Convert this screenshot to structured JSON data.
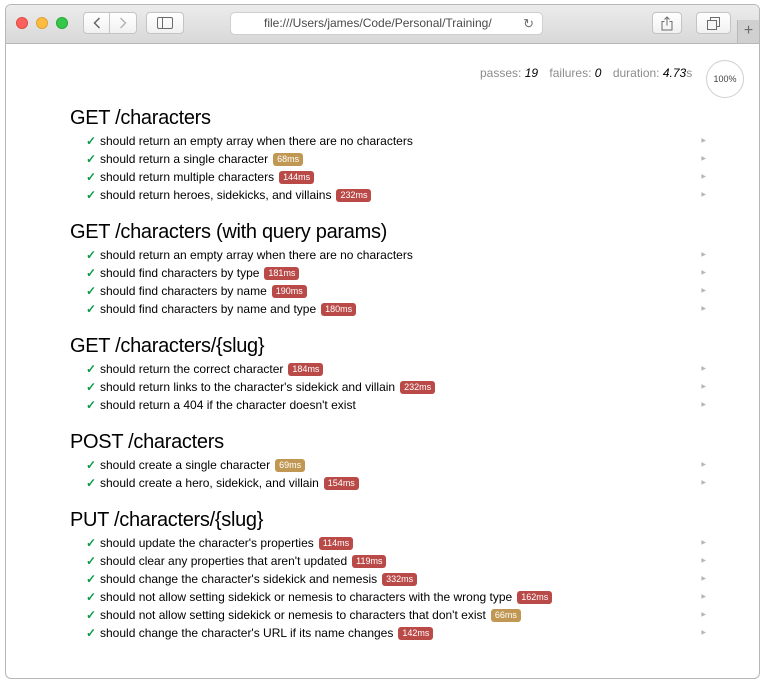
{
  "browser": {
    "url": "file:///Users/james/Code/Personal/Training/",
    "newtab_label": "+"
  },
  "stats": {
    "passes_label": "passes:",
    "passes": "19",
    "failures_label": "failures:",
    "failures": "0",
    "duration_label": "duration:",
    "duration": "4.73",
    "duration_unit": "s",
    "progress": "100%"
  },
  "colors": {
    "pass": "#0a9a4a",
    "medium": "#c09853",
    "slow": "#b94a48"
  },
  "suites": [
    {
      "title": "GET /characters",
      "tests": [
        {
          "title": "should return an empty array when there are no characters",
          "duration": "",
          "speed": "fast"
        },
        {
          "title": "should return a single character",
          "duration": "68ms",
          "speed": "medium"
        },
        {
          "title": "should return multiple characters",
          "duration": "144ms",
          "speed": "slow"
        },
        {
          "title": "should return heroes, sidekicks, and villains",
          "duration": "232ms",
          "speed": "slow"
        }
      ]
    },
    {
      "title": "GET /characters (with query params)",
      "tests": [
        {
          "title": "should return an empty array when there are no characters",
          "duration": "",
          "speed": "fast"
        },
        {
          "title": "should find characters by type",
          "duration": "181ms",
          "speed": "slow"
        },
        {
          "title": "should find characters by name",
          "duration": "190ms",
          "speed": "slow"
        },
        {
          "title": "should find characters by name and type",
          "duration": "180ms",
          "speed": "slow"
        }
      ]
    },
    {
      "title": "GET /characters/{slug}",
      "tests": [
        {
          "title": "should return the correct character",
          "duration": "184ms",
          "speed": "slow"
        },
        {
          "title": "should return links to the character's sidekick and villain",
          "duration": "232ms",
          "speed": "slow"
        },
        {
          "title": "should return a 404 if the character doesn't exist",
          "duration": "",
          "speed": "fast"
        }
      ]
    },
    {
      "title": "POST /characters",
      "tests": [
        {
          "title": "should create a single character",
          "duration": "69ms",
          "speed": "medium"
        },
        {
          "title": "should create a hero, sidekick, and villain",
          "duration": "154ms",
          "speed": "slow"
        }
      ]
    },
    {
      "title": "PUT /characters/{slug}",
      "tests": [
        {
          "title": "should update the character's properties",
          "duration": "114ms",
          "speed": "slow"
        },
        {
          "title": "should clear any properties that aren't updated",
          "duration": "119ms",
          "speed": "slow"
        },
        {
          "title": "should change the character's sidekick and nemesis",
          "duration": "332ms",
          "speed": "slow"
        },
        {
          "title": "should not allow setting sidekick or nemesis to characters with the wrong type",
          "duration": "162ms",
          "speed": "slow"
        },
        {
          "title": "should not allow setting sidekick or nemesis to characters that don't exist",
          "duration": "66ms",
          "speed": "medium"
        },
        {
          "title": "should change the character's URL if its name changes",
          "duration": "142ms",
          "speed": "slow"
        }
      ]
    }
  ]
}
